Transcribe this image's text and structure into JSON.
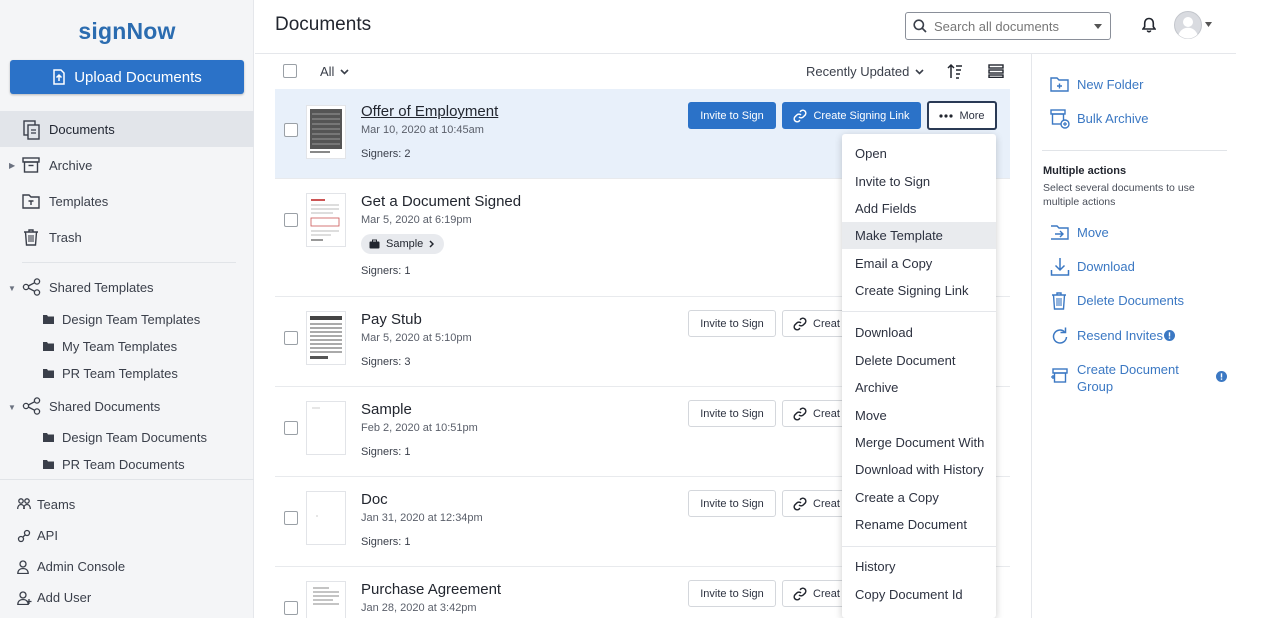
{
  "app": {
    "logo": "signNow"
  },
  "sidebar": {
    "upload_label": "Upload Documents",
    "items": [
      {
        "label": "Documents"
      },
      {
        "label": "Archive"
      },
      {
        "label": "Templates"
      },
      {
        "label": "Trash"
      }
    ],
    "shared_templates": {
      "label": "Shared Templates",
      "children": [
        {
          "label": "Design Team Templates"
        },
        {
          "label": "My Team Templates"
        },
        {
          "label": "PR Team Templates"
        }
      ]
    },
    "shared_documents": {
      "label": "Shared Documents",
      "children": [
        {
          "label": "Design Team Documents"
        },
        {
          "label": "PR Team Documents"
        }
      ]
    },
    "bottom": [
      {
        "label": "Teams"
      },
      {
        "label": "API"
      },
      {
        "label": "Admin Console"
      },
      {
        "label": "Add User"
      }
    ]
  },
  "header": {
    "title": "Documents",
    "search_placeholder": "Search all documents"
  },
  "toolbar": {
    "filter": "All",
    "sort": "Recently Updated"
  },
  "documents": [
    {
      "name": "Offer of Employment",
      "date": "Mar 10, 2020 at 10:45am",
      "signers": "Signers: 2"
    },
    {
      "name": "Get a Document Signed",
      "date": "Mar 5, 2020 at 6:19pm",
      "tag": "Sample",
      "signers": "Signers: 1"
    },
    {
      "name": "Pay Stub",
      "date": "Mar 5, 2020 at 5:10pm",
      "signers": "Signers: 3"
    },
    {
      "name": "Sample",
      "date": "Feb 2, 2020 at 10:51pm",
      "signers": "Signers: 1"
    },
    {
      "name": "Doc",
      "date": "Jan 31, 2020 at 12:34pm",
      "signers": "Signers: 1"
    },
    {
      "name": "Purchase Agreement",
      "date": "Jan 28, 2020 at 3:42pm"
    }
  ],
  "row_actions": {
    "invite": "Invite to Sign",
    "create_link": "Create Signing Link",
    "create_link_truncated": "Creat",
    "more": "More"
  },
  "more_menu": {
    "group1": [
      "Open",
      "Invite to Sign",
      "Add Fields",
      "Make Template",
      "Email a Copy",
      "Create Signing Link"
    ],
    "group2": [
      "Download",
      "Delete Document",
      "Archive",
      "Move",
      "Merge Document With",
      "Download with History",
      "Create a Copy",
      "Rename Document"
    ],
    "group3": [
      "History",
      "Copy Document Id"
    ],
    "hovered": "Make Template"
  },
  "right_panel": {
    "new_folder": "New Folder",
    "bulk_archive": "Bulk Archive",
    "multi_title": "Multiple actions",
    "multi_desc": "Select several documents to use multiple actions",
    "actions": [
      {
        "label": "Move"
      },
      {
        "label": "Download"
      },
      {
        "label": "Delete Documents"
      },
      {
        "label": "Resend Invites"
      },
      {
        "label": "Create Document Group"
      }
    ]
  },
  "colors": {
    "primary": "#2b72c8",
    "link": "#3b78c3",
    "logo": "#2b6cb0",
    "selected_row": "#e8f0fa"
  }
}
